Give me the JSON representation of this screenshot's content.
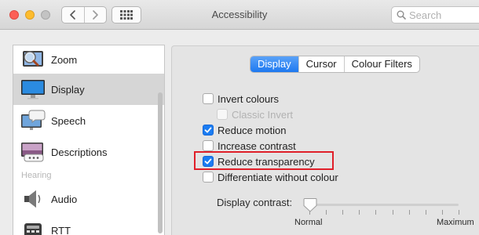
{
  "window": {
    "title": "Accessibility"
  },
  "toolbar": {
    "back_icon": "chevron-left-icon",
    "forward_icon": "chevron-right-icon",
    "grid_icon": "grid-icon"
  },
  "search": {
    "placeholder": "Search",
    "value": ""
  },
  "sidebar": {
    "items": [
      {
        "label": "Zoom",
        "icon": "zoom-icon",
        "selected": false
      },
      {
        "label": "Display",
        "icon": "display-icon",
        "selected": true
      },
      {
        "label": "Speech",
        "icon": "speech-icon",
        "selected": false
      },
      {
        "label": "Descriptions",
        "icon": "descriptions-icon",
        "selected": false
      }
    ],
    "section_header": "Hearing",
    "items_hearing": [
      {
        "label": "Audio",
        "icon": "audio-icon",
        "selected": false
      },
      {
        "label": "RTT",
        "icon": "rtt-icon",
        "selected": false
      }
    ]
  },
  "tabs": [
    {
      "label": "Display",
      "active": true
    },
    {
      "label": "Cursor",
      "active": false
    },
    {
      "label": "Colour Filters",
      "active": false
    }
  ],
  "options": [
    {
      "label": "Invert colours",
      "checked": false,
      "disabled": false
    },
    {
      "label": "Classic Invert",
      "checked": false,
      "disabled": true
    },
    {
      "label": "Reduce motion",
      "checked": true,
      "disabled": false
    },
    {
      "label": "Increase contrast",
      "checked": false,
      "disabled": false
    },
    {
      "label": "Reduce transparency",
      "checked": true,
      "disabled": false
    },
    {
      "label": "Differentiate without colour",
      "checked": false,
      "disabled": false
    }
  ],
  "contrast": {
    "label": "Display contrast:",
    "min_label": "Normal",
    "max_label": "Maximum",
    "value": 0
  },
  "colors": {
    "accent": "#1b7cf2",
    "highlight": "#e0202a"
  }
}
